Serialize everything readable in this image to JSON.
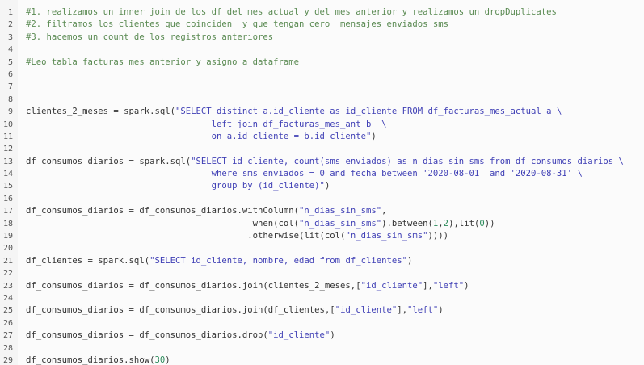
{
  "colors": {
    "background": "#fbfbfb",
    "gutter": "#f5f5f5",
    "line_number": "#555555",
    "plain": "#333333",
    "comment": "#5a8a52",
    "string": "#3f3fb5",
    "number": "#2a8a5a"
  },
  "editor": {
    "lines": [
      {
        "num": "1",
        "tokens": [
          {
            "t": "comment",
            "v": "#1. realizamos un inner join de los df del mes actual y del mes anterior y realizamos un dropDuplicates"
          }
        ]
      },
      {
        "num": "2",
        "tokens": [
          {
            "t": "comment",
            "v": "#2. filtramos los clientes que coinciden  y que tengan cero  mensajes enviados sms"
          }
        ]
      },
      {
        "num": "3",
        "tokens": [
          {
            "t": "comment",
            "v": "#3. hacemos un count de los registros anteriores"
          }
        ]
      },
      {
        "num": "4",
        "tokens": []
      },
      {
        "num": "5",
        "tokens": [
          {
            "t": "comment",
            "v": "#Leo tabla facturas mes anterior y asigno a dataframe"
          }
        ]
      },
      {
        "num": "6",
        "tokens": []
      },
      {
        "num": "7",
        "tokens": []
      },
      {
        "num": "8",
        "tokens": []
      },
      {
        "num": "9",
        "tokens": [
          {
            "t": "plain",
            "v": "clientes_2_meses = spark.sql("
          },
          {
            "t": "string",
            "v": "\"SELECT distinct a.id_cliente as id_cliente FROM df_facturas_mes_actual a \\"
          }
        ]
      },
      {
        "num": "10",
        "tokens": [
          {
            "t": "string",
            "v": "                                    left join df_facturas_mes_ant b  \\"
          }
        ]
      },
      {
        "num": "11",
        "tokens": [
          {
            "t": "string",
            "v": "                                    on a.id_cliente = b.id_cliente\""
          },
          {
            "t": "plain",
            "v": ")"
          }
        ]
      },
      {
        "num": "12",
        "tokens": []
      },
      {
        "num": "13",
        "tokens": [
          {
            "t": "plain",
            "v": "df_consumos_diarios = spark.sql("
          },
          {
            "t": "string",
            "v": "\"SELECT id_cliente, count(sms_enviados) as n_dias_sin_sms from df_consumos_diarios \\"
          }
        ]
      },
      {
        "num": "14",
        "tokens": [
          {
            "t": "string",
            "v": "                                    where sms_enviados = 0 and fecha between '2020-08-01' and '2020-08-31' \\"
          }
        ]
      },
      {
        "num": "15",
        "tokens": [
          {
            "t": "string",
            "v": "                                    group by (id_cliente)\""
          },
          {
            "t": "plain",
            "v": ")"
          }
        ]
      },
      {
        "num": "16",
        "tokens": []
      },
      {
        "num": "17",
        "tokens": [
          {
            "t": "plain",
            "v": "df_consumos_diarios = df_consumos_diarios.withColumn("
          },
          {
            "t": "string",
            "v": "\"n_dias_sin_sms\""
          },
          {
            "t": "plain",
            "v": ","
          }
        ]
      },
      {
        "num": "18",
        "tokens": [
          {
            "t": "plain",
            "v": "                                            when(col("
          },
          {
            "t": "string",
            "v": "\"n_dias_sin_sms\""
          },
          {
            "t": "plain",
            "v": ").between("
          },
          {
            "t": "number",
            "v": "1"
          },
          {
            "t": "plain",
            "v": ","
          },
          {
            "t": "number",
            "v": "2"
          },
          {
            "t": "plain",
            "v": "),lit("
          },
          {
            "t": "number",
            "v": "0"
          },
          {
            "t": "plain",
            "v": "))"
          }
        ]
      },
      {
        "num": "19",
        "tokens": [
          {
            "t": "plain",
            "v": "                                           .otherwise(lit(col("
          },
          {
            "t": "string",
            "v": "\"n_dias_sin_sms\""
          },
          {
            "t": "plain",
            "v": "))))"
          }
        ]
      },
      {
        "num": "20",
        "tokens": []
      },
      {
        "num": "21",
        "tokens": [
          {
            "t": "plain",
            "v": "df_clientes = spark.sql("
          },
          {
            "t": "string",
            "v": "\"SELECT id_cliente, nombre, edad from df_clientes\""
          },
          {
            "t": "plain",
            "v": ")"
          }
        ]
      },
      {
        "num": "22",
        "tokens": []
      },
      {
        "num": "23",
        "tokens": [
          {
            "t": "plain",
            "v": "df_consumos_diarios = df_consumos_diarios.join(clientes_2_meses,["
          },
          {
            "t": "string",
            "v": "\"id_cliente\""
          },
          {
            "t": "plain",
            "v": "],"
          },
          {
            "t": "string",
            "v": "\"left\""
          },
          {
            "t": "plain",
            "v": ")"
          }
        ]
      },
      {
        "num": "24",
        "tokens": []
      },
      {
        "num": "25",
        "tokens": [
          {
            "t": "plain",
            "v": "df_consumos_diarios = df_consumos_diarios.join(df_clientes,["
          },
          {
            "t": "string",
            "v": "\"id_cliente\""
          },
          {
            "t": "plain",
            "v": "],"
          },
          {
            "t": "string",
            "v": "\"left\""
          },
          {
            "t": "plain",
            "v": ")"
          }
        ]
      },
      {
        "num": "26",
        "tokens": []
      },
      {
        "num": "27",
        "tokens": [
          {
            "t": "plain",
            "v": "df_consumos_diarios = df_consumos_diarios.drop("
          },
          {
            "t": "string",
            "v": "\"id_cliente\""
          },
          {
            "t": "plain",
            "v": ")"
          }
        ]
      },
      {
        "num": "28",
        "tokens": []
      },
      {
        "num": "29",
        "tokens": [
          {
            "t": "plain",
            "v": "df_consumos_diarios.show("
          },
          {
            "t": "number",
            "v": "30"
          },
          {
            "t": "plain",
            "v": ")"
          }
        ]
      }
    ]
  }
}
